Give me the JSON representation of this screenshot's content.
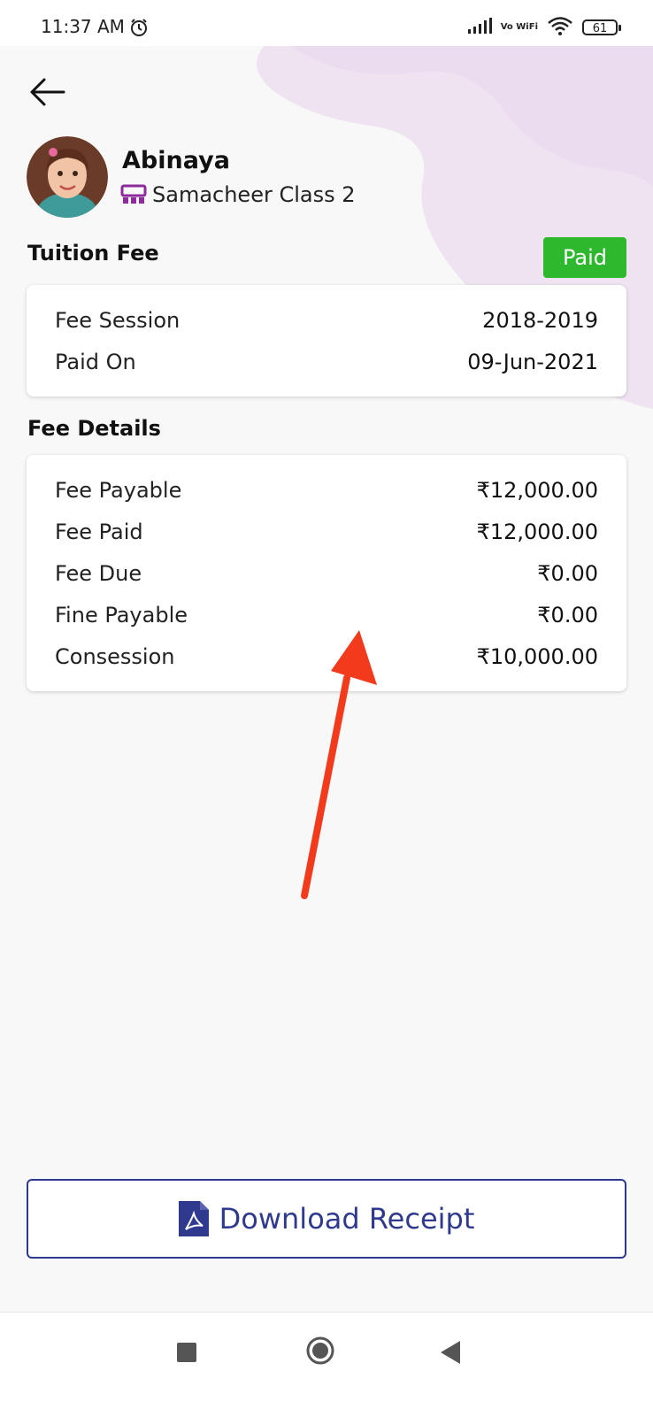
{
  "status_bar": {
    "time": "11:37 AM",
    "network_label": "Vo WiFi",
    "battery": "61"
  },
  "student": {
    "name": "Abinaya",
    "class_name": "Samacheer Class 2"
  },
  "tuition": {
    "title": "Tuition Fee",
    "status": "Paid",
    "status_color": "#2eb82e",
    "rows": [
      {
        "label": "Fee Session",
        "value": "2018-2019"
      },
      {
        "label": "Paid On",
        "value": "09-Jun-2021"
      }
    ]
  },
  "fee_details": {
    "title": "Fee Details",
    "rows": [
      {
        "label": "Fee Payable",
        "value": "₹12,000.00"
      },
      {
        "label": "Fee Paid",
        "value": "₹12,000.00"
      },
      {
        "label": "Fee Due",
        "value": "₹0.00"
      },
      {
        "label": "Fine Payable",
        "value": "₹0.00"
      },
      {
        "label": "Consession",
        "value": "₹10,000.00"
      }
    ]
  },
  "actions": {
    "download_label": "Download Receipt"
  },
  "colors": {
    "accent": "#2f3a8f",
    "class_icon": "#8e2b9c",
    "annotation_arrow": "#f23a1c"
  },
  "icons": {
    "back": "arrow-left-icon",
    "class": "classroom-icon",
    "pdf": "pdf-icon",
    "alarm": "alarm-clock-icon"
  }
}
